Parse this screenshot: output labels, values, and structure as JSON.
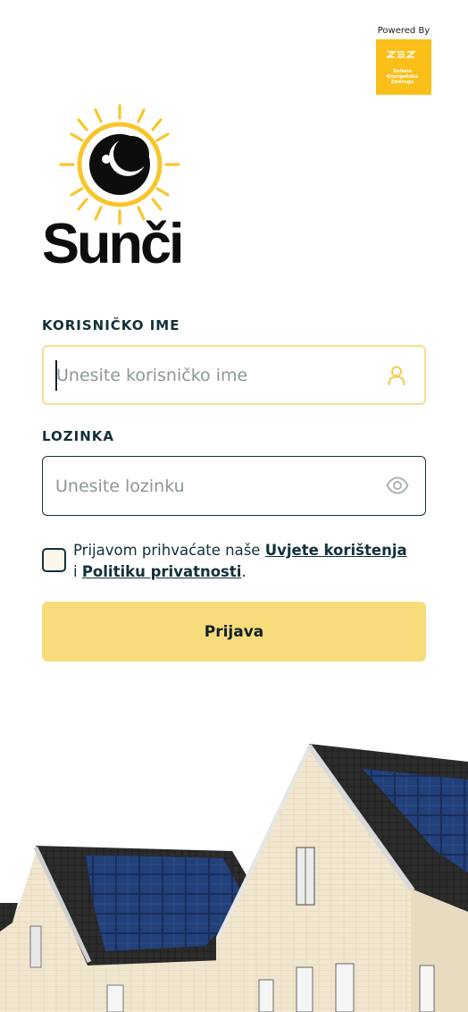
{
  "powered_by": {
    "label": "Powered By",
    "partner_mark": "ZEZ",
    "partner_name_lines": [
      "Zelena",
      "Energetska",
      "Zadruga"
    ],
    "badge_color": "#fbbf1a"
  },
  "brand": {
    "name": "Sunči",
    "logo_icon": "sun-moon-icon",
    "accent": "#f8c62a"
  },
  "form": {
    "username": {
      "label": "KORISNIČKO IME",
      "placeholder": "Unesite korisničko ime",
      "value": "",
      "icon": "user-icon"
    },
    "password": {
      "label": "LOZINKA",
      "placeholder": "Unesite lozinku",
      "value": "",
      "icon": "eye-icon"
    },
    "consent": {
      "checked": false,
      "prefix": "Prijavom prihvaćate naše ",
      "terms_link": "Uvjete korištenja",
      "connector": " i ",
      "privacy_link": "Politiku privatnosti",
      "suffix": "."
    },
    "submit_label": "Prijava",
    "button_color": "#f8dc7c"
  },
  "hero_image": "solar-houses-illustration"
}
